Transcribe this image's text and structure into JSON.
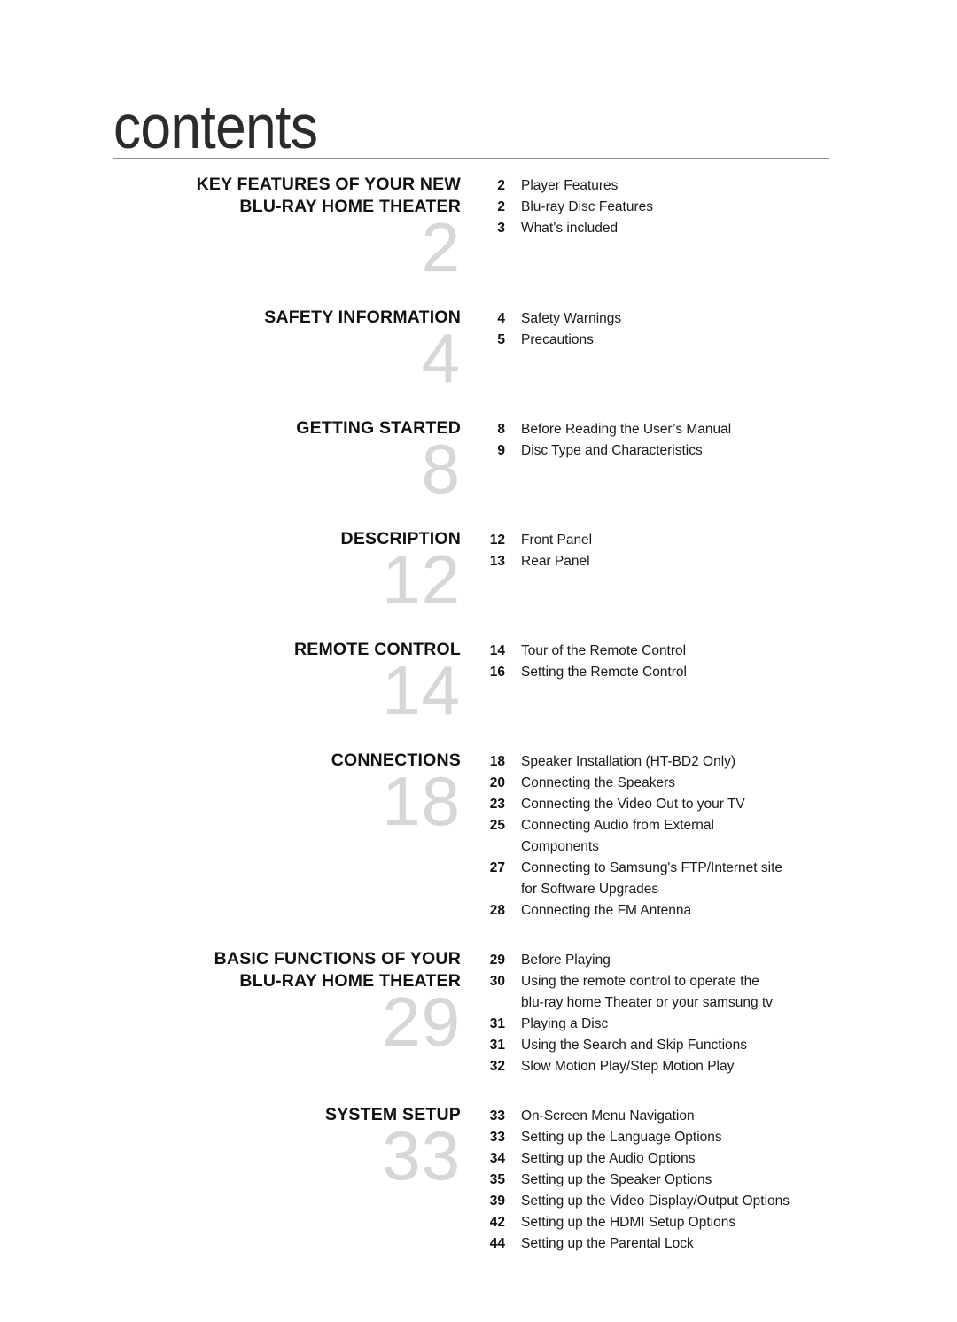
{
  "page": {
    "title": "contents"
  },
  "sections": [
    {
      "heading": "KEY FEATURES OF YOUR NEW\nBLU-RAY HOME THEATER",
      "watermark": "2",
      "entries": [
        {
          "page": "2",
          "title": "Player Features"
        },
        {
          "page": "2",
          "title": "Blu-ray Disc Features"
        },
        {
          "page": "3",
          "title": "What’s included"
        }
      ]
    },
    {
      "heading": "SAFETY INFORMATION",
      "watermark": "4",
      "entries": [
        {
          "page": "4",
          "title": "Safety Warnings"
        },
        {
          "page": "5",
          "title": "Precautions"
        }
      ]
    },
    {
      "heading": "GETTING STARTED",
      "watermark": "8",
      "entries": [
        {
          "page": "8",
          "title": "Before Reading the User’s Manual"
        },
        {
          "page": "9",
          "title": "Disc Type and Characteristics"
        }
      ]
    },
    {
      "heading": "DESCRIPTION",
      "watermark": "12",
      "entries": [
        {
          "page": "12",
          "title": "Front Panel"
        },
        {
          "page": "13",
          "title": "Rear Panel"
        }
      ]
    },
    {
      "heading": "REMOTE CONTROL",
      "watermark": "14",
      "entries": [
        {
          "page": "14",
          "title": "Tour of the Remote Control"
        },
        {
          "page": "16",
          "title": "Setting the Remote Control"
        }
      ]
    },
    {
      "heading": "CONNECTIONS",
      "watermark": "18",
      "entries": [
        {
          "page": "18",
          "title": "Speaker Installation (HT-BD2 Only)"
        },
        {
          "page": "20",
          "title": "Connecting the Speakers"
        },
        {
          "page": "23",
          "title": "Connecting the Video Out to your TV"
        },
        {
          "page": "25",
          "title": "Connecting Audio from External\nComponents"
        },
        {
          "page": "27",
          "title": "Connecting to Samsung's FTP/Internet site\nfor Software Upgrades"
        },
        {
          "page": "28",
          "title": "Connecting the FM Antenna"
        }
      ]
    },
    {
      "heading": "BASIC FUNCTIONS OF YOUR\nBLU-RAY HOME THEATER",
      "watermark": "29",
      "entries": [
        {
          "page": "29",
          "title": "Before Playing"
        },
        {
          "page": "30",
          "title": "Using the remote control to operate the\nblu-ray home Theater or your samsung tv"
        },
        {
          "page": "31",
          "title": "Playing a Disc"
        },
        {
          "page": "31",
          "title": "Using the Search and Skip Functions"
        },
        {
          "page": "32",
          "title": "Slow Motion Play/Step Motion Play"
        }
      ]
    },
    {
      "heading": "SYSTEM SETUP",
      "watermark": "33",
      "entries": [
        {
          "page": "33",
          "title": "On-Screen Menu Navigation"
        },
        {
          "page": "33",
          "title": "Setting up the Language Options"
        },
        {
          "page": "34",
          "title": "Setting up the Audio Options"
        },
        {
          "page": "35",
          "title": "Setting up the Speaker Options"
        },
        {
          "page": "39",
          "title": "Setting up the Video Display/Output Options"
        },
        {
          "page": "42",
          "title": "Setting up the HDMI Setup Options"
        },
        {
          "page": "44",
          "title": "Setting up the Parental Lock"
        }
      ]
    }
  ]
}
